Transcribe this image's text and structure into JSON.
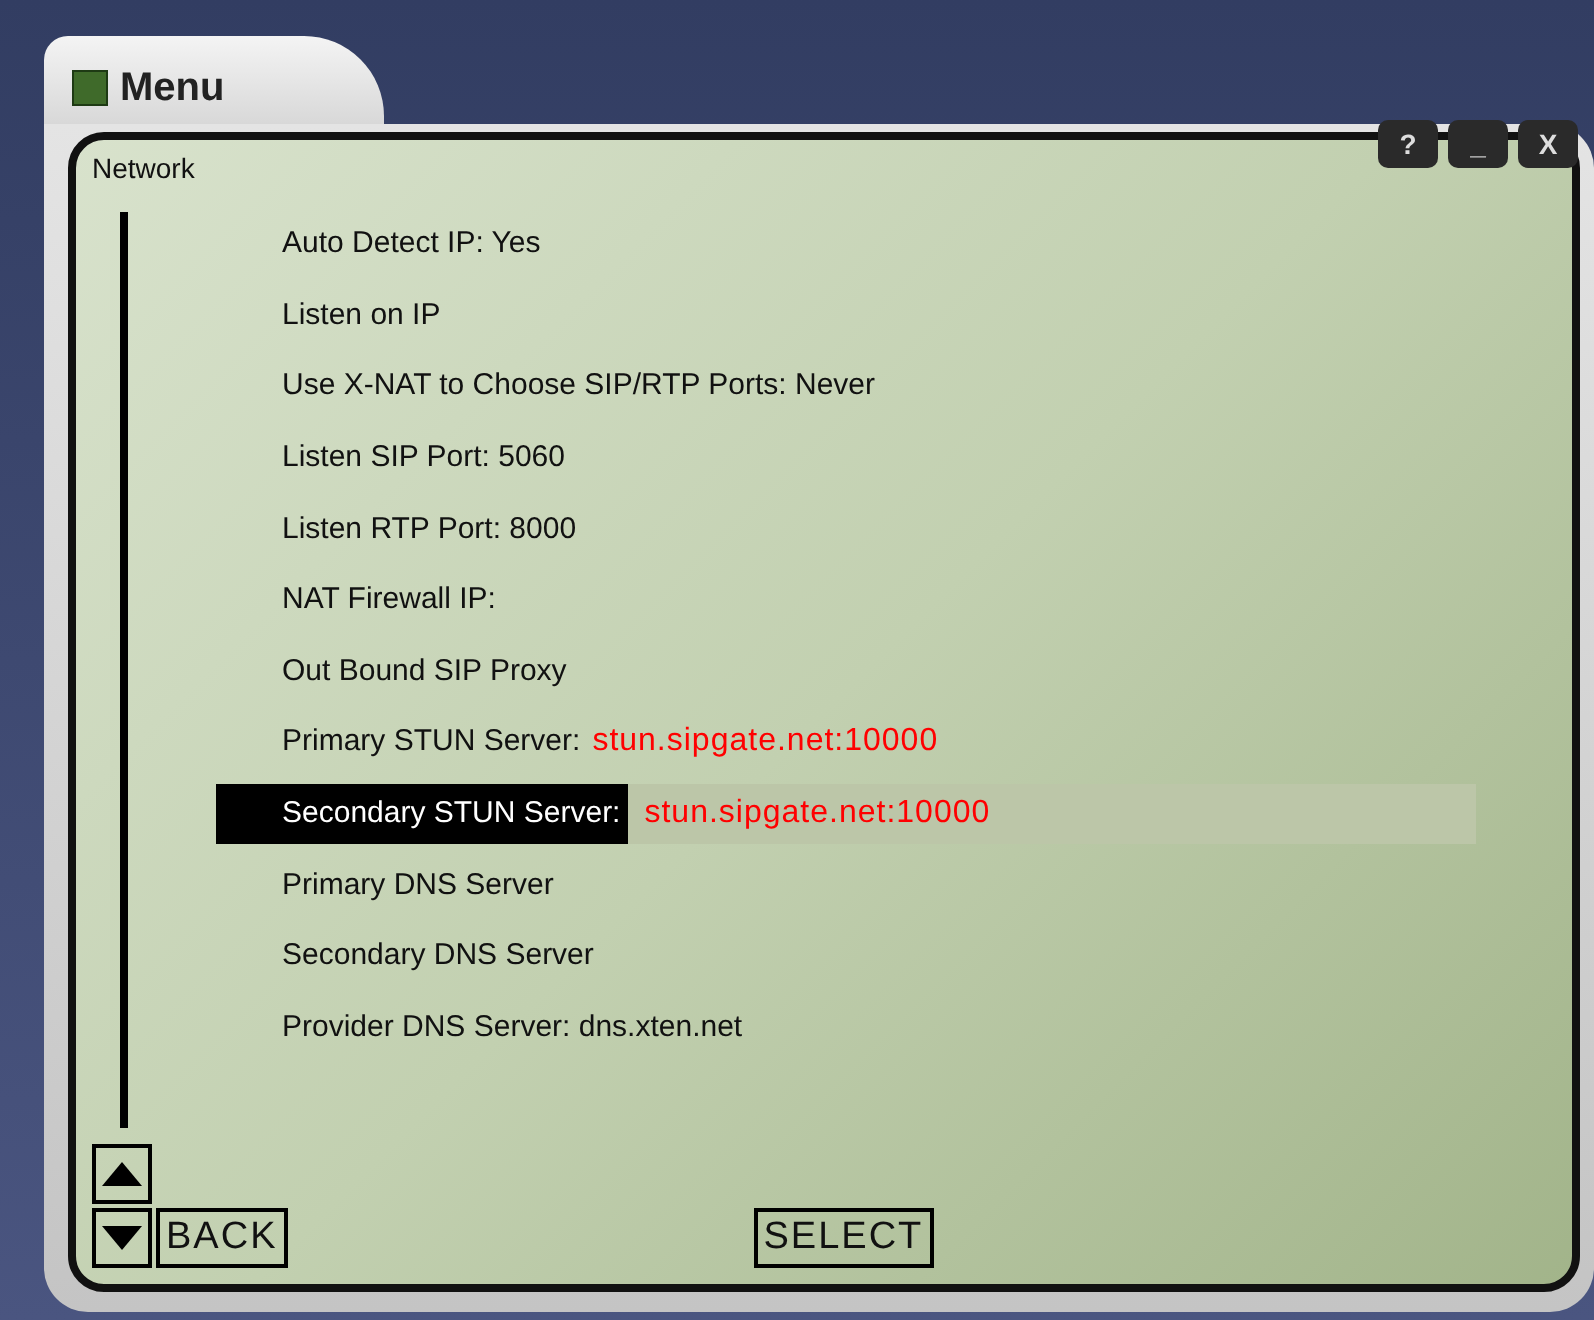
{
  "window": {
    "title": "Menu",
    "buttons": [
      "?",
      "_",
      "X"
    ]
  },
  "screen": {
    "title": "Network"
  },
  "items": [
    {
      "label": "Auto Detect IP: Yes",
      "selected": false
    },
    {
      "label": "Listen on IP",
      "selected": false
    },
    {
      "label": "Use X-NAT to Choose SIP/RTP Ports: Never",
      "selected": false
    },
    {
      "label": "Listen SIP Port: 5060",
      "selected": false
    },
    {
      "label": "Listen RTP Port: 8000",
      "selected": false
    },
    {
      "label": "NAT Firewall IP:",
      "selected": false
    },
    {
      "label": "Out Bound SIP Proxy",
      "selected": false
    },
    {
      "label": "Primary STUN Server:",
      "value": "stun.sipgate.net:10000",
      "selected": false
    },
    {
      "label": "Secondary STUN Server:",
      "value": "stun.sipgate.net:10000",
      "selected": true
    },
    {
      "label": "Primary DNS Server",
      "selected": false
    },
    {
      "label": "Secondary DNS Server",
      "selected": false
    },
    {
      "label": "Provider DNS Server: dns.xten.net",
      "selected": false
    }
  ],
  "softkeys": {
    "left": "BACK",
    "center": "SELECT"
  }
}
